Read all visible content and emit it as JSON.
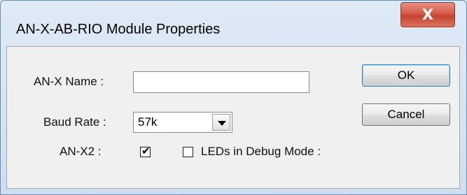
{
  "window": {
    "title": "AN-X-AB-RIO Module Properties",
    "close_glyph": "X"
  },
  "form": {
    "name_label": "AN-X Name :",
    "name_value": "",
    "baud_label": "Baud Rate :",
    "baud_value": "57k",
    "anx2_label": "AN-X2 :",
    "anx2_checked": true,
    "debug_label": "LEDs in Debug Mode :",
    "debug_checked": false
  },
  "buttons": {
    "ok": "OK",
    "cancel": "Cancel"
  },
  "icons": {
    "close": "close-icon",
    "dropdown": "chevron-down-icon",
    "check": "checkmark-icon"
  }
}
